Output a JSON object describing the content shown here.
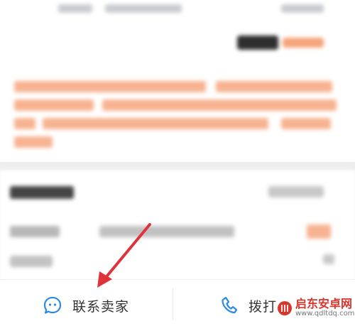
{
  "contact_bar": {
    "contact_seller_label": "联系卖家",
    "call_label": "拨打"
  },
  "watermark": {
    "brand": "启东安卓网",
    "url": "www.qdltdq.com"
  },
  "colors": {
    "accent_orange": "#f5a37a",
    "icon_blue": "#2a8be0",
    "arrow_red": "#e0323a"
  }
}
